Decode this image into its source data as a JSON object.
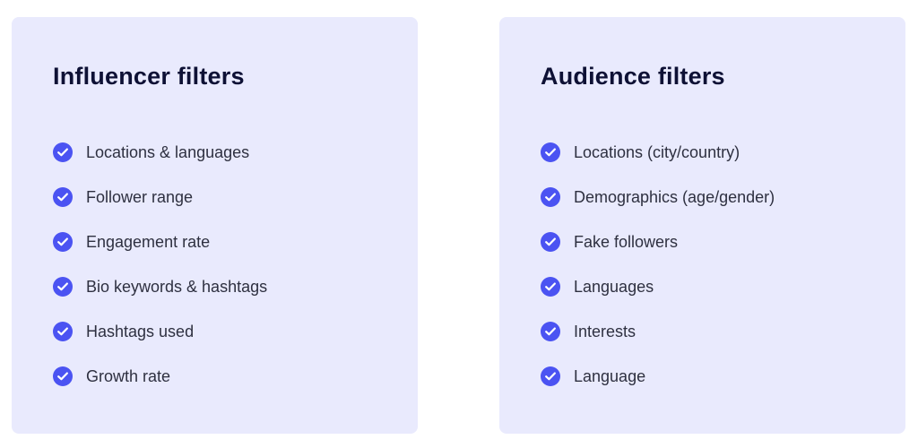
{
  "colors": {
    "card_background": "#e9eafd",
    "check_icon": "#4b53f2",
    "title_text": "#0e1135",
    "item_text": "#2e3040"
  },
  "influencer": {
    "title": "Influencer filters",
    "items": [
      {
        "label": "Locations & languages",
        "icon": "check-circle-icon"
      },
      {
        "label": "Follower range",
        "icon": "check-circle-icon"
      },
      {
        "label": "Engagement rate",
        "icon": "check-circle-icon"
      },
      {
        "label": "Bio keywords & hashtags",
        "icon": "check-circle-icon"
      },
      {
        "label": "Hashtags used",
        "icon": "check-circle-icon"
      },
      {
        "label": "Growth rate",
        "icon": "check-circle-icon"
      }
    ]
  },
  "audience": {
    "title": "Audience filters",
    "items": [
      {
        "label": "Locations (city/country)",
        "icon": "check-circle-icon"
      },
      {
        "label": "Demographics (age/gender)",
        "icon": "check-circle-icon"
      },
      {
        "label": "Fake followers",
        "icon": "check-circle-icon"
      },
      {
        "label": "Languages",
        "icon": "check-circle-icon"
      },
      {
        "label": "Interests",
        "icon": "check-circle-icon"
      },
      {
        "label": "Language",
        "icon": "check-circle-icon"
      }
    ]
  }
}
